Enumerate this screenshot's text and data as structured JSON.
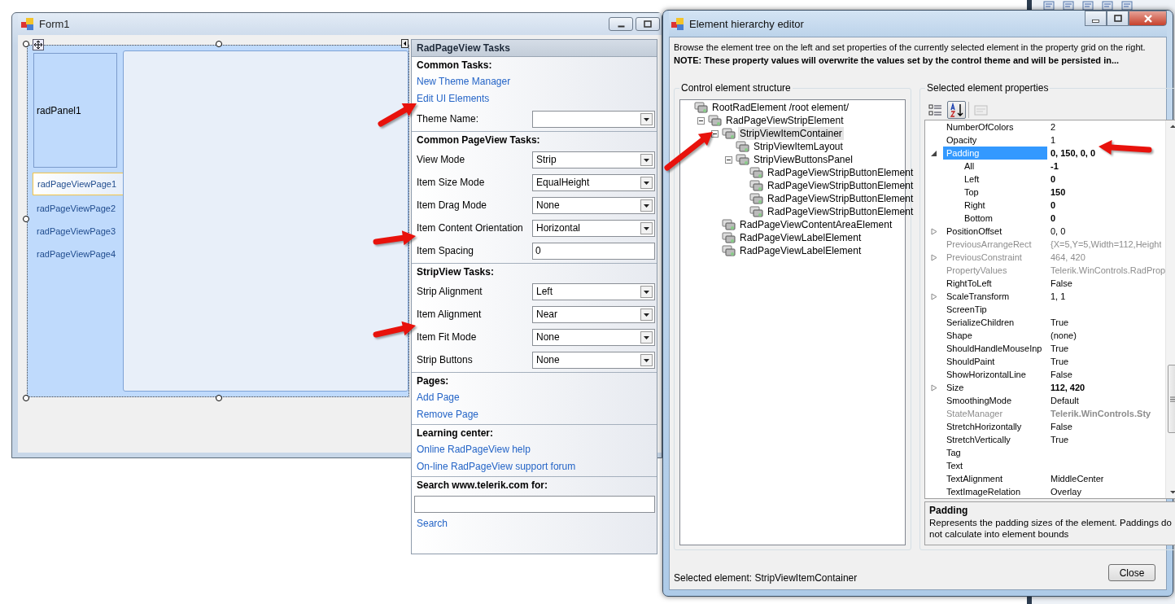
{
  "form": {
    "title": "Form1",
    "panel_label": "radPanel1",
    "pages": [
      {
        "label": "radPageViewPage1",
        "selected": true
      },
      {
        "label": "radPageViewPage2",
        "selected": false
      },
      {
        "label": "radPageViewPage3",
        "selected": false
      },
      {
        "label": "radPageViewPage4",
        "selected": false
      }
    ]
  },
  "tasks": {
    "title": "RadPageView Tasks",
    "sections": [
      {
        "heading": "Common Tasks:",
        "items": [
          {
            "kind": "link",
            "label": "New Theme Manager"
          },
          {
            "kind": "link",
            "label": "Edit UI Elements"
          },
          {
            "kind": "combo",
            "label": "Theme Name:"
          }
        ]
      },
      {
        "heading": "Common PageView Tasks:",
        "items": [
          {
            "kind": "combo",
            "label": "View Mode",
            "value": "Strip"
          },
          {
            "kind": "combo",
            "label": "Item Size Mode",
            "value": "EqualHeight"
          },
          {
            "kind": "combo",
            "label": "Item Drag Mode",
            "value": "None"
          },
          {
            "kind": "combo",
            "label": "Item Content Orientation",
            "value": "Horizontal"
          },
          {
            "kind": "textbox",
            "label": "Item Spacing",
            "value": "0"
          }
        ]
      },
      {
        "heading": "StripView Tasks:",
        "items": [
          {
            "kind": "combo",
            "label": "Strip Alignment",
            "value": "Left"
          },
          {
            "kind": "combo",
            "label": "Item Alignment",
            "value": "Near"
          },
          {
            "kind": "combo",
            "label": "Item Fit Mode",
            "value": "None"
          },
          {
            "kind": "combo",
            "label": "Strip Buttons",
            "value": "None"
          }
        ]
      },
      {
        "heading": "Pages:",
        "items": [
          {
            "kind": "link",
            "label": "Add Page"
          },
          {
            "kind": "link",
            "label": "Remove Page"
          }
        ]
      },
      {
        "heading": "Learning center:",
        "items": [
          {
            "kind": "link",
            "label": "Online RadPageView help"
          },
          {
            "kind": "link",
            "label": "On-line RadPageView support forum"
          }
        ]
      },
      {
        "heading": "Search www.telerik.com for:",
        "items": [
          {
            "kind": "textbox"
          },
          {
            "kind": "link",
            "label": "Search"
          }
        ]
      }
    ]
  },
  "dialog": {
    "title": "Element hierarchy editor",
    "description": "Browse the element tree on the left and set properties of the currently selected element in the property grid on the right.",
    "note": "NOTE: These property values will overwrite the values set by the control theme and will be persisted in...",
    "tree_group": "Control element structure",
    "tree": {
      "label": "RootRadElement /root element/",
      "selected": false,
      "children": [
        {
          "label": "RadPageViewStripElement",
          "selected": false,
          "expanded": true,
          "children": [
            {
              "label": "StripViewItemContainer",
              "selected": true,
              "expanded": true,
              "children": [
                {
                  "label": "StripViewItemLayout",
                  "selected": false
                },
                {
                  "label": "StripViewButtonsPanel",
                  "selected": false,
                  "expanded": true,
                  "children": [
                    {
                      "label": "RadPageViewStripButtonElement",
                      "selected": false
                    },
                    {
                      "label": "RadPageViewStripButtonElement",
                      "selected": false
                    },
                    {
                      "label": "RadPageViewStripButtonElement",
                      "selected": false
                    },
                    {
                      "label": "RadPageViewStripButtonElement",
                      "selected": false
                    }
                  ]
                }
              ]
            },
            {
              "label": "RadPageViewContentAreaElement",
              "selected": false
            },
            {
              "label": "RadPageViewLabelElement",
              "selected": false
            },
            {
              "label": "RadPageViewLabelElement",
              "selected": false
            }
          ]
        }
      ]
    },
    "properties_group": "Selected element properties",
    "toolbar": [
      {
        "kind": "categorized",
        "selected": false,
        "disabled": false
      },
      {
        "kind": "alphabetical",
        "selected": true,
        "disabled": false
      },
      {
        "kind": "pages",
        "selected": false,
        "disabled": true
      }
    ],
    "properties": [
      {
        "name": "NumberOfColors",
        "value": "2",
        "selected": false,
        "modified": false,
        "disabled": false
      },
      {
        "name": "Opacity",
        "value": "1",
        "selected": false,
        "modified": false,
        "disabled": false
      },
      {
        "name": "Padding",
        "value": "0, 150, 0, 0",
        "selected": true,
        "modified": true,
        "disabled": false,
        "expanded": true,
        "children": [
          {
            "name": "All",
            "value": "-1",
            "selected": false,
            "modified": true,
            "disabled": false
          },
          {
            "name": "Left",
            "value": "0",
            "selected": false,
            "modified": true,
            "disabled": false
          },
          {
            "name": "Top",
            "value": "150",
            "selected": false,
            "modified": true,
            "disabled": false
          },
          {
            "name": "Right",
            "value": "0",
            "selected": false,
            "modified": true,
            "disabled": false
          },
          {
            "name": "Bottom",
            "value": "0",
            "selected": false,
            "modified": true,
            "disabled": false
          }
        ]
      },
      {
        "name": "PositionOffset",
        "value": "0, 0",
        "selected": false,
        "modified": false,
        "disabled": false,
        "expanded": false
      },
      {
        "name": "PreviousArrangeRect",
        "value": "{X=5,Y=5,Width=112,Height",
        "selected": false,
        "modified": false,
        "disabled": true
      },
      {
        "name": "PreviousConstraint",
        "value": "464, 420",
        "selected": false,
        "modified": false,
        "disabled": true,
        "expanded": false
      },
      {
        "name": "PropertyValues",
        "value": "Telerik.WinControls.RadProp",
        "selected": false,
        "modified": false,
        "disabled": true
      },
      {
        "name": "RightToLeft",
        "value": "False",
        "selected": false,
        "modified": false,
        "disabled": false
      },
      {
        "name": "ScaleTransform",
        "value": "1, 1",
        "selected": false,
        "modified": false,
        "disabled": false,
        "expanded": false
      },
      {
        "name": "ScreenTip",
        "selected": false,
        "disabled": false
      },
      {
        "name": "SerializeChildren",
        "value": "True",
        "selected": false,
        "modified": false,
        "disabled": false
      },
      {
        "name": "Shape",
        "value": "(none)",
        "selected": false,
        "modified": false,
        "disabled": false
      },
      {
        "name": "ShouldHandleMouseInp",
        "value": "True",
        "selected": false,
        "modified": false,
        "disabled": false
      },
      {
        "name": "ShouldPaint",
        "value": "True",
        "selected": false,
        "modified": false,
        "disabled": false
      },
      {
        "name": "ShowHorizontalLine",
        "value": "False",
        "selected": false,
        "modified": false,
        "disabled": false
      },
      {
        "name": "Size",
        "value": "112, 420",
        "selected": false,
        "modified": true,
        "disabled": false,
        "expanded": false
      },
      {
        "name": "SmoothingMode",
        "value": "Default",
        "selected": false,
        "modified": false,
        "disabled": false
      },
      {
        "name": "StateManager",
        "value": "Telerik.WinControls.Sty",
        "selected": false,
        "modified": true,
        "disabled": true
      },
      {
        "name": "StretchHorizontally",
        "value": "False",
        "selected": false,
        "modified": false,
        "disabled": false
      },
      {
        "name": "StretchVertically",
        "value": "True",
        "selected": false,
        "modified": false,
        "disabled": false
      },
      {
        "name": "Tag",
        "selected": false,
        "disabled": false
      },
      {
        "name": "Text",
        "selected": false,
        "disabled": false
      },
      {
        "name": "TextAlignment",
        "value": "MiddleCenter",
        "selected": false,
        "modified": false,
        "disabled": false
      },
      {
        "name": "TextImageRelation",
        "value": "Overlay",
        "selected": false,
        "modified": false,
        "disabled": false
      }
    ],
    "help_title": "Padding",
    "help_text": "Represents the padding sizes of the element. Paddings do not calculate into element bounds",
    "status": "Selected element: StripViewItemContainer",
    "close_button": "Close"
  }
}
